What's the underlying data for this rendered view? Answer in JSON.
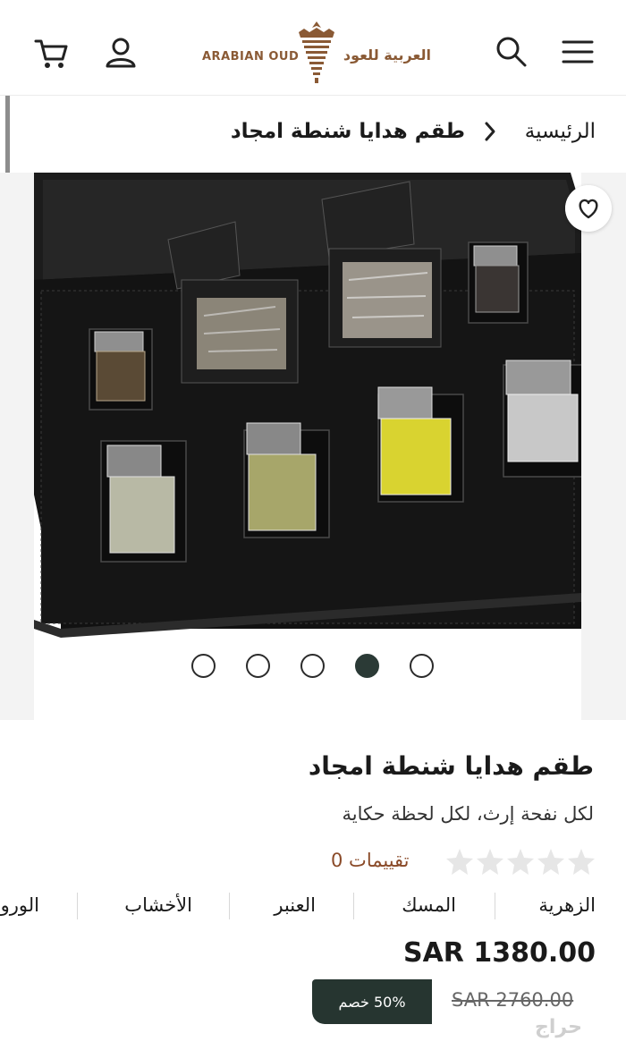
{
  "header": {
    "logo_en": "ARABIAN OUD",
    "logo_ar": "العربية للعود",
    "icons": {
      "menu": "menu-icon",
      "search": "search-icon",
      "account": "user-icon",
      "cart": "cart-icon"
    }
  },
  "breadcrumb": {
    "home": "الرئيسية",
    "current": "طقم هدايا شنطة امجاد"
  },
  "gallery": {
    "image_alt": "Gift set case with perfume bottles and oud wood chips",
    "slide_count": 5,
    "active_slide": 4
  },
  "product": {
    "title": "طقم هدايا شنطة امجاد",
    "tagline": "لكل نفحة إرث، لكل لحظة حكاية",
    "rating_stars": 0,
    "ratings_label": "تقييمات 0",
    "notes": [
      "الزهرية",
      "المسك",
      "العنبر",
      "الأخشاب",
      "الورو"
    ],
    "price": "SAR 1380.00",
    "old_price": "SAR 2760.00",
    "discount": "50% خصم"
  },
  "colors": {
    "brand": "#8a5a35",
    "accent_dark": "#263530",
    "rating_text": "#8a4a28"
  },
  "watermark": "حراج"
}
